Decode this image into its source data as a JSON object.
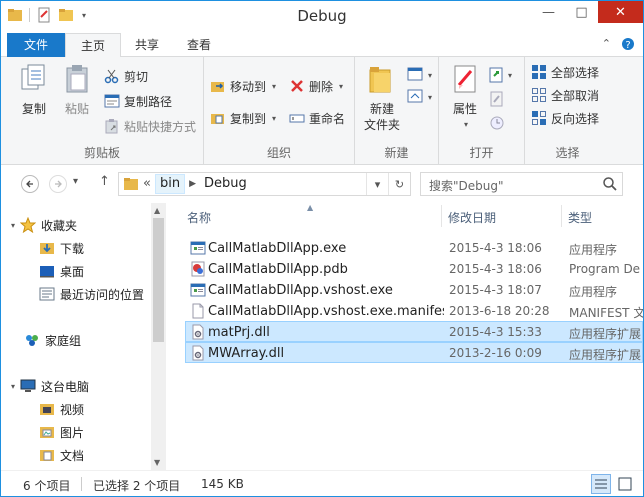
{
  "window": {
    "title": "Debug"
  },
  "titlebar": {
    "minimize": "—",
    "maximize": "□",
    "close": "✕"
  },
  "tabs": {
    "file": "文件",
    "home": "主页",
    "share": "共享",
    "view": "查看"
  },
  "ribbon": {
    "clipboard": {
      "label": "剪贴板",
      "copy": "复制",
      "paste": "粘贴",
      "cut": "剪切",
      "copy_path": "复制路径",
      "paste_shortcut": "粘贴快捷方式"
    },
    "organize": {
      "label": "组织",
      "move_to": "移动到",
      "copy_to": "复制到",
      "delete": "删除",
      "rename": "重命名"
    },
    "new": {
      "label": "新建",
      "new_folder_line1": "新建",
      "new_folder_line2": "文件夹"
    },
    "open": {
      "label": "打开",
      "properties": "属性"
    },
    "select": {
      "label": "选择",
      "select_all": "全部选择",
      "select_none": "全部取消",
      "invert": "反向选择"
    }
  },
  "address": {
    "overflow": "«",
    "crumbs": [
      "bin",
      "Debug"
    ],
    "search_placeholder": "搜索\"Debug\""
  },
  "navpane": {
    "favorites": "收藏夹",
    "downloads": "下载",
    "desktop": "桌面",
    "recent": "最近访问的位置",
    "homegroup": "家庭组",
    "this_pc": "这台电脑",
    "videos": "视频",
    "pictures": "图片",
    "documents": "文档"
  },
  "columns": {
    "name": "名称",
    "date": "修改日期",
    "type": "类型"
  },
  "files": [
    {
      "name": "CallMatlabDllApp.exe",
      "date": "2015-4-3 18:06",
      "type": "应用程序",
      "icon": "exe-icon",
      "selected": false
    },
    {
      "name": "CallMatlabDllApp.pdb",
      "date": "2015-4-3 18:06",
      "type": "Program De",
      "icon": "pdb-icon",
      "selected": false
    },
    {
      "name": "CallMatlabDllApp.vshost.exe",
      "date": "2015-4-3 18:07",
      "type": "应用程序",
      "icon": "exe-icon",
      "selected": false
    },
    {
      "name": "CallMatlabDllApp.vshost.exe.manifest",
      "date": "2013-6-18 20:28",
      "type": "MANIFEST 文",
      "icon": "manifest-icon",
      "selected": false
    },
    {
      "name": "matPrj.dll",
      "date": "2015-4-3 15:33",
      "type": "应用程序扩展",
      "icon": "dll-icon",
      "selected": true
    },
    {
      "name": "MWArray.dll",
      "date": "2013-2-16 0:09",
      "type": "应用程序扩展",
      "icon": "dll-icon",
      "selected": true
    }
  ],
  "status": {
    "count": "6 个项目",
    "selected": "已选择 2 个项目",
    "size": "145 KB"
  }
}
